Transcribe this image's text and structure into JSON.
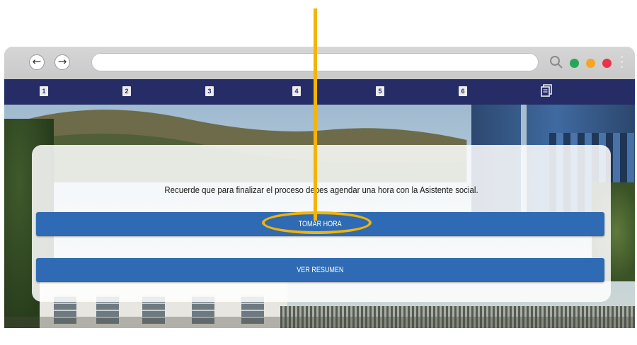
{
  "step_bar": {
    "steps": [
      "1",
      "2",
      "3",
      "4",
      "5",
      "6"
    ],
    "final_step_icon": "document-icon"
  },
  "dialog": {
    "message": "Recuerde que para finalizar el proceso debes agendar una hora con la Asistente social.",
    "primary_button": "TOMAR HORA",
    "secondary_button": "VER RESUMEN"
  },
  "colors": {
    "step_bar": "#262d66",
    "button": "#2e6bb4",
    "highlight": "#f4b400",
    "dot_green": "#26a65b",
    "dot_orange": "#f5a623",
    "dot_red": "#e8334a"
  }
}
